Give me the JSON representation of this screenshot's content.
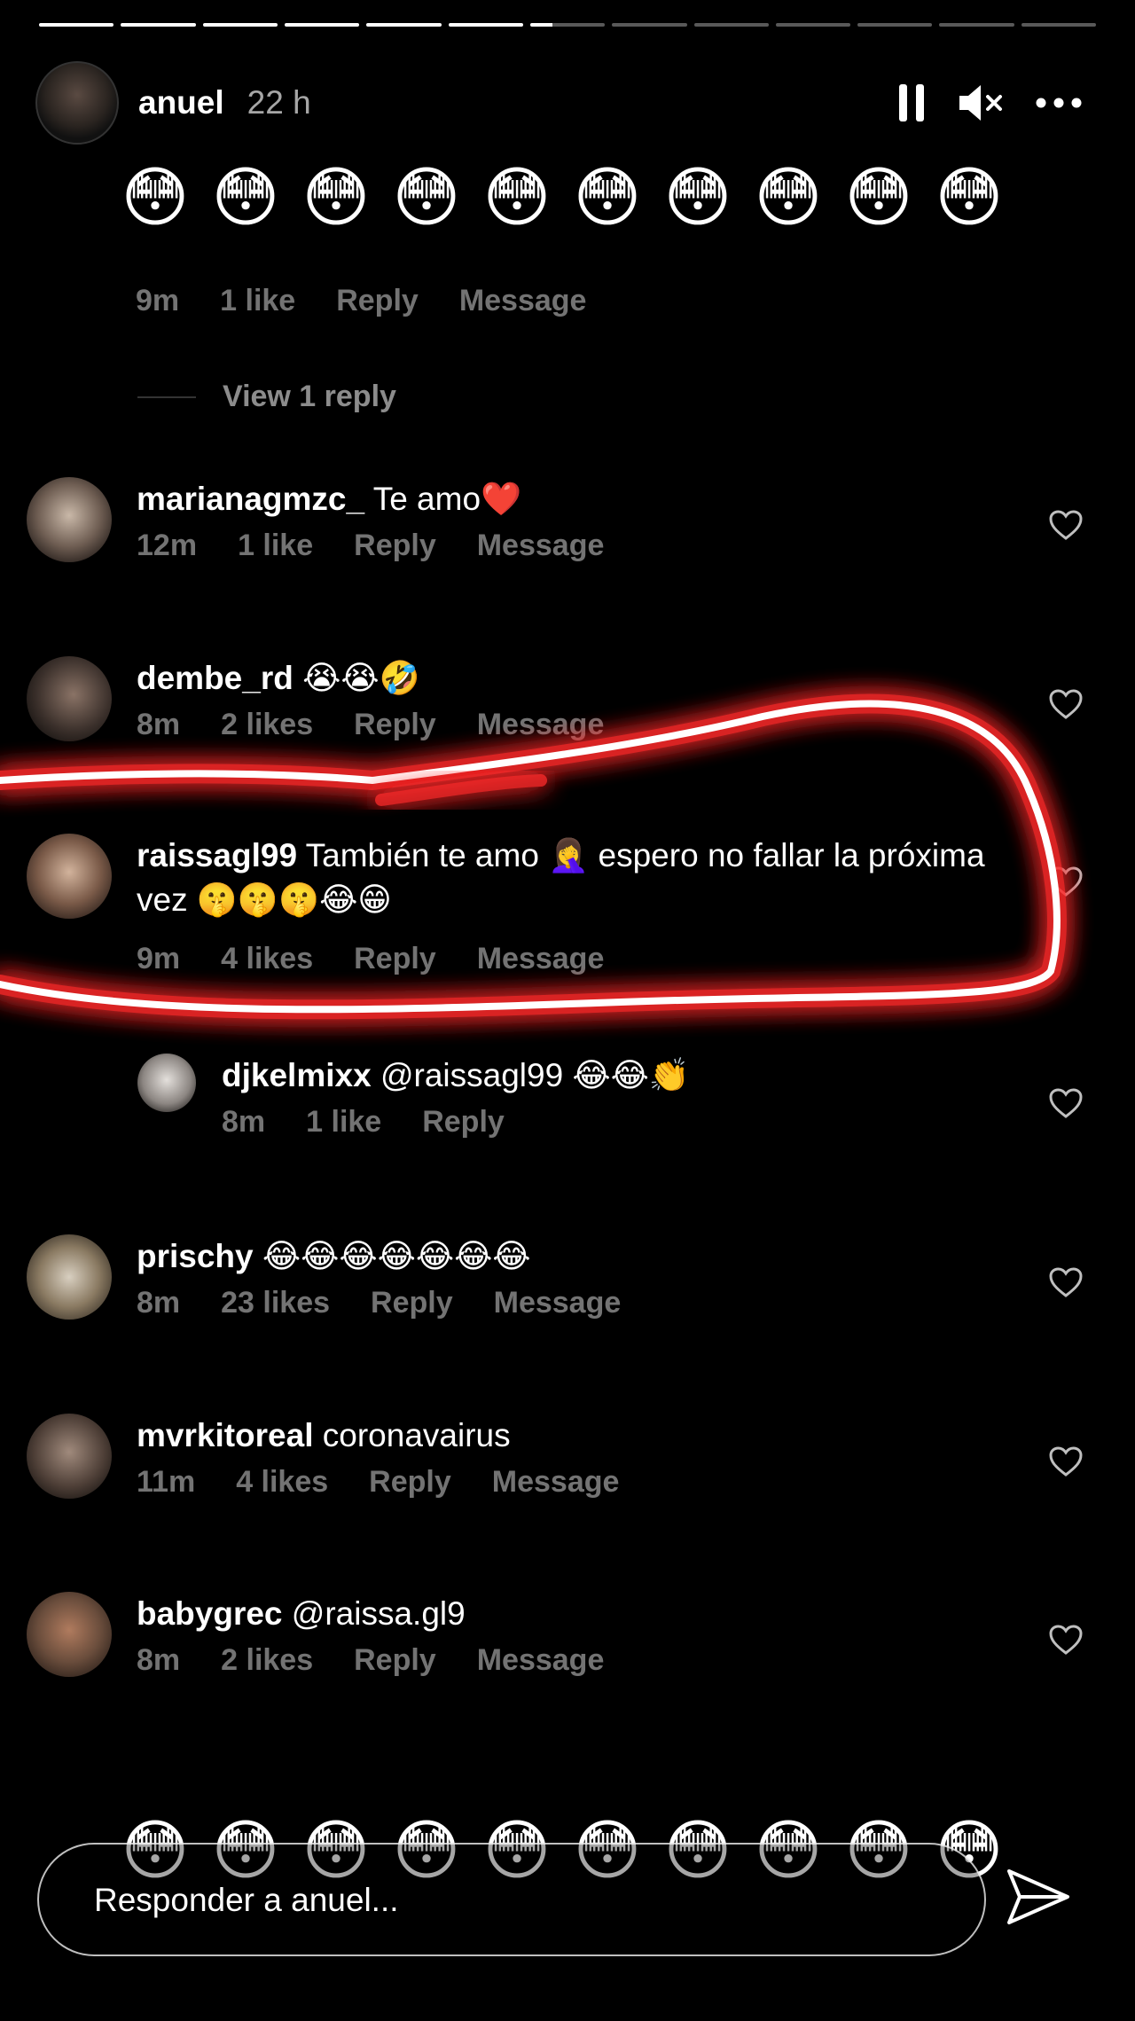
{
  "progress": [
    1,
    1,
    1,
    1,
    1,
    1,
    0.3,
    0,
    0,
    0,
    0,
    0,
    0
  ],
  "header": {
    "username": "anuel",
    "time": "22 h"
  },
  "top_comment": {
    "emojis": [
      "😳",
      "😳",
      "😳",
      "😳",
      "😳",
      "😳",
      "😳",
      "😳",
      "😳",
      "😳"
    ],
    "meta": {
      "time": "9m",
      "likes": "1 like",
      "reply": "Reply",
      "message": "Message"
    }
  },
  "view_reply": "View 1 reply",
  "comments": [
    {
      "user": "marianagmzc_",
      "text": "Te amo❤️",
      "time": "12m",
      "likes": "1 like",
      "reply": "Reply",
      "message": "Message"
    },
    {
      "user": "dembe_rd",
      "text": "😭😭🤣",
      "time": "8m",
      "likes": "2 likes",
      "reply": "Reply",
      "message": "Message"
    },
    {
      "user": "raissagl99",
      "text": "También te amo 🤦‍♀️ espero no fallar la próxima vez 🤫🤫🤫😂😁",
      "time": "9m",
      "likes": "4 likes",
      "reply": "Reply",
      "message": "Message"
    },
    {
      "user": "prischy",
      "text": "😂😂😂😂😂😂😂",
      "time": "8m",
      "likes": "23 likes",
      "reply": "Reply",
      "message": "Message"
    },
    {
      "user": "mvrkitoreal",
      "text": "coronavairus",
      "time": "11m",
      "likes": "4 likes",
      "reply": "Reply",
      "message": "Message"
    },
    {
      "user": "babygrec",
      "text": "@raissa.gl9",
      "time": "8m",
      "likes": "2 likes",
      "reply": "Reply",
      "message": "Message"
    }
  ],
  "reply": {
    "user": "djkelmixx",
    "text": "@raissagl99 😂😂👏",
    "time": "8m",
    "likes": "1 like",
    "reply": "Reply"
  },
  "bottom_emojis": [
    "😳",
    "😳",
    "😳",
    "😳",
    "😳",
    "😳",
    "😳",
    "😳",
    "😳",
    "😳"
  ],
  "reply_bar": {
    "placeholder": "Responder a anuel..."
  },
  "colors": {
    "background": "#000000",
    "highlight": "#ff2a2a"
  },
  "icons": {
    "pause": "pause-icon",
    "mute": "mute-icon",
    "more": "more-icon",
    "heart": "heart-icon",
    "send": "send-icon"
  }
}
